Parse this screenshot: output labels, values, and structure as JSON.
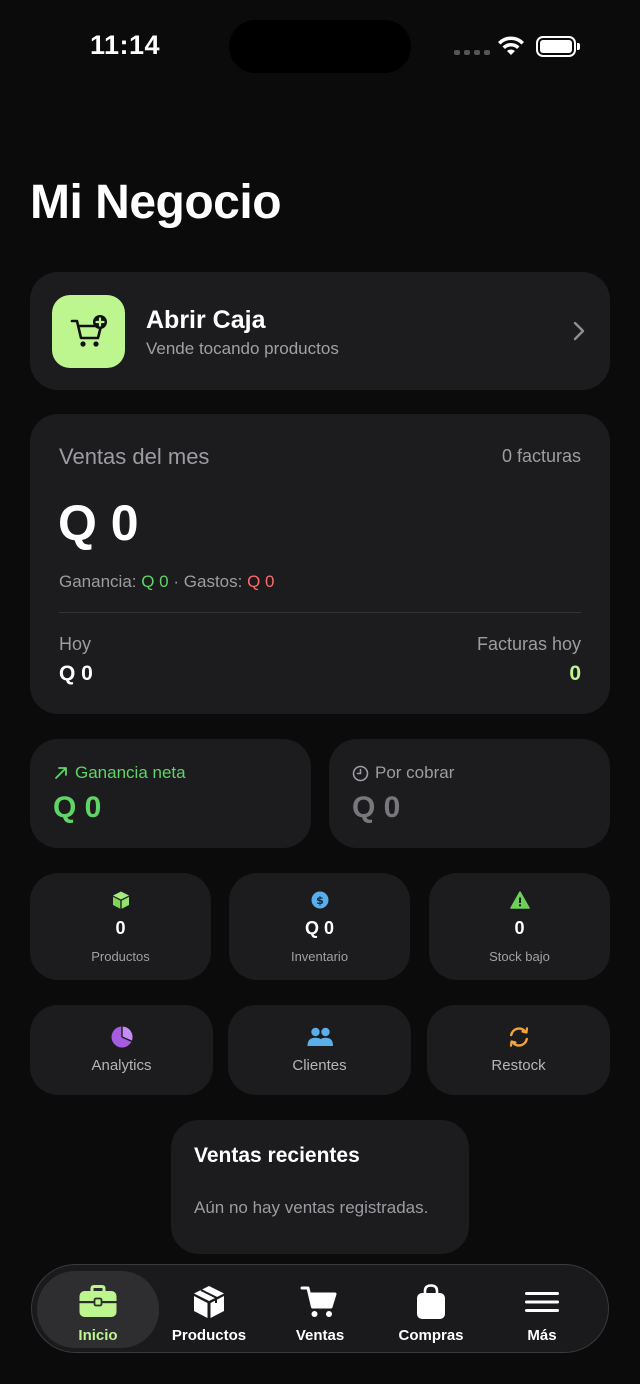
{
  "status_bar": {
    "time": "11:14"
  },
  "page_title": "Mi Negocio",
  "open_register": {
    "title": "Abrir Caja",
    "subtitle": "Vende tocando productos"
  },
  "sales": {
    "label": "Ventas del mes",
    "invoices": "0 facturas",
    "amount": "Q 0",
    "profit_label": "Ganancia:",
    "profit_value": "Q 0",
    "separator": "·",
    "expenses_label": "Gastos:",
    "expenses_value": "Q 0",
    "today_label": "Hoy",
    "today_value": "Q 0",
    "invoices_today_label": "Facturas hoy",
    "invoices_today_value": "0"
  },
  "net_profit": {
    "label": "Ganancia neta",
    "value": "Q 0"
  },
  "receivable": {
    "label": "Por cobrar",
    "value": "Q 0"
  },
  "stats": [
    {
      "value": "0",
      "label": "Productos",
      "icon": "box-icon"
    },
    {
      "value": "Q 0",
      "label": "Inventario",
      "icon": "dollar-icon"
    },
    {
      "value": "0",
      "label": "Stock bajo",
      "icon": "warning-icon"
    }
  ],
  "actions": [
    {
      "label": "Analytics",
      "icon": "pie-chart-icon"
    },
    {
      "label": "Clientes",
      "icon": "people-icon"
    },
    {
      "label": "Restock",
      "icon": "refresh-icon"
    }
  ],
  "recent_sales": {
    "title": "Ventas recientes",
    "empty": "Aún no hay ventas registradas."
  },
  "tabs": [
    {
      "label": "Inicio",
      "icon": "briefcase-icon",
      "active": true
    },
    {
      "label": "Productos",
      "icon": "package-icon"
    },
    {
      "label": "Ventas",
      "icon": "cart-icon"
    },
    {
      "label": "Compras",
      "icon": "bag-icon"
    },
    {
      "label": "Más",
      "icon": "menu-icon"
    }
  ],
  "colors": {
    "accent": "#bdf58f",
    "green": "#5fd467",
    "red": "#ff6b6b",
    "card": "#1c1c1e",
    "background": "#0b0b0c"
  }
}
